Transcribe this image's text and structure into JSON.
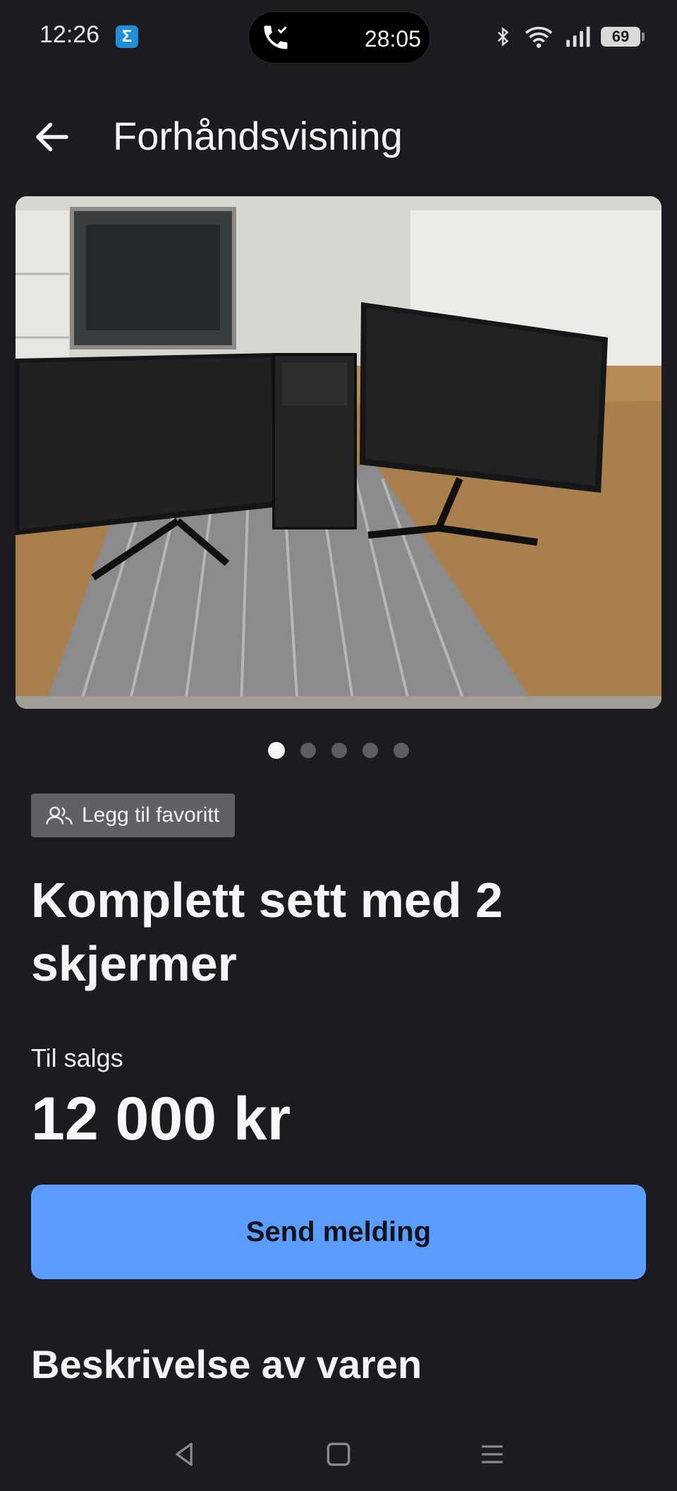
{
  "status_bar": {
    "time": "12:26",
    "app_badge": "Σ",
    "call_time": "28:05",
    "battery": "69",
    "icons": [
      "phone-icon",
      "bluetooth-icon",
      "wifi-icon",
      "signal-icon",
      "battery-icon"
    ]
  },
  "header": {
    "title": "Forhåndsvisning",
    "back_icon": "arrow-left-icon"
  },
  "gallery": {
    "image_description": "photo",
    "page_count": 5,
    "active_page": 1
  },
  "favorite": {
    "label": "Legg til favoritt",
    "icon": "users-icon"
  },
  "listing": {
    "title": "Komplett sett med 2 skjermer",
    "sale_label": "Til salgs",
    "price": "12 000 kr"
  },
  "actions": {
    "send_label": "Send melding"
  },
  "description": {
    "heading": "Beskrivelse av varen"
  },
  "colors": {
    "background": "#1b1b20",
    "accent": "#5b9cff",
    "chip": "#5f5f66"
  },
  "navbar": {
    "icons": [
      "back-triangle-icon",
      "home-square-icon",
      "menu-lines-icon"
    ]
  }
}
